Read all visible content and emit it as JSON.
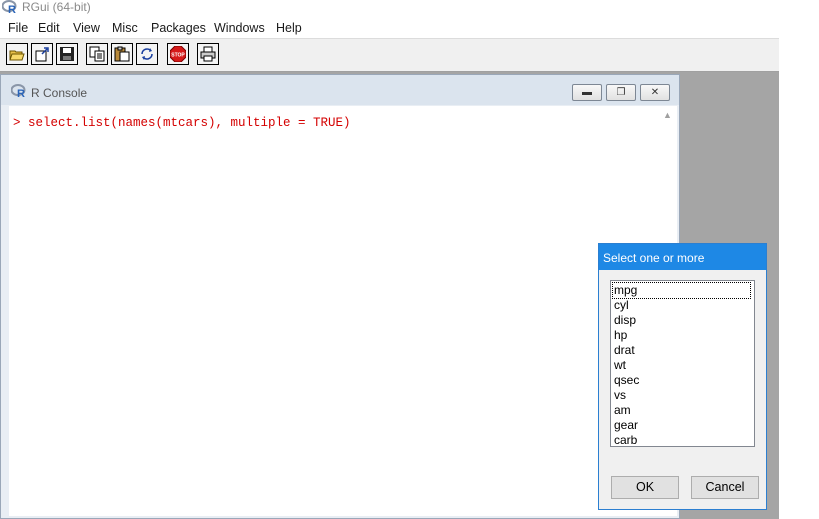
{
  "app": {
    "title": "RGui (64-bit)"
  },
  "menu": [
    "File",
    "Edit",
    "View",
    "Misc",
    "Packages",
    "Windows",
    "Help"
  ],
  "toolbar": {
    "icons": [
      "open-script-icon",
      "load-workspace-icon",
      "save-workspace-icon",
      "copy-icon",
      "paste-icon",
      "copy-paste-icon",
      "stop-icon",
      "print-icon"
    ]
  },
  "console": {
    "title": "R Console",
    "line": "> select.list(names(mtcars), multiple = TRUE)",
    "text_color": "#d40000"
  },
  "dialog": {
    "title": "Select one or more",
    "items": [
      "mpg",
      "cyl",
      "disp",
      "hp",
      "drat",
      "wt",
      "qsec",
      "vs",
      "am",
      "gear",
      "carb"
    ],
    "focused_item": "mpg",
    "ok_label": "OK",
    "cancel_label": "Cancel",
    "accent_color": "#1e88e5"
  }
}
